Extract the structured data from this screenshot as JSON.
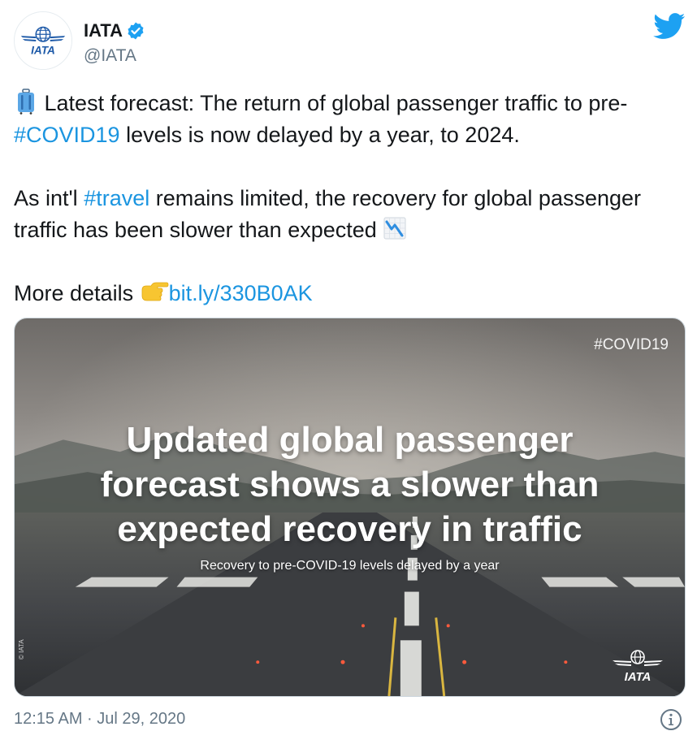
{
  "author": {
    "display_name": "IATA",
    "handle": "@IATA",
    "verified": true,
    "avatar_text": "IATA"
  },
  "icons": {
    "avatar": "iata-logo-icon",
    "verified": "verified-badge-icon",
    "brand": "twitter-bird-icon",
    "luggage": "luggage-emoji-icon",
    "chart_decreasing": "chart-decreasing-emoji-icon",
    "pointing_hand": "pointing-right-emoji-icon",
    "info": "info-icon"
  },
  "tweet": {
    "line1_pre": "Latest forecast: The return of global passenger traffic to pre-",
    "hashtag_covid": "#COVID19",
    "line1_post": " levels is now delayed by a year, to 2024.",
    "line2_pre": "As int'l ",
    "hashtag_travel": "#travel",
    "line2_post": " remains limited, the recovery for global passenger traffic has been slower than expected ",
    "line3_pre": "More details ",
    "link": "bit.ly/330B0AK"
  },
  "media": {
    "tag": "#COVID19",
    "headline_1": "Updated global passenger",
    "headline_2": "forecast shows a slower than",
    "headline_3": "expected recovery in traffic",
    "subheadline": "Recovery to pre-COVID-19 levels delayed by a year",
    "copyright": "© IATA",
    "logo_text": "IATA"
  },
  "footer": {
    "timestamp": "12:15 AM · Jul 29, 2020"
  },
  "colors": {
    "link": "#1b95e0",
    "verified": "#1da1f2",
    "twitter_blue": "#1da1f2",
    "iata_blue": "#1e5aa8"
  }
}
